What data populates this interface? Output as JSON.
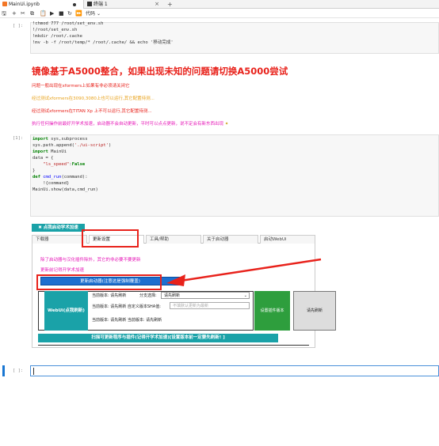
{
  "tabs": [
    {
      "label": "MainUi.ipynb",
      "icon": "notebook-icon"
    },
    {
      "label": "终端 1",
      "icon": "terminal-icon"
    }
  ],
  "toolbar": {
    "cell_type": "代码",
    "icons": [
      "save-icon",
      "add-icon",
      "cut-icon",
      "copy-icon",
      "paste-icon",
      "run-icon",
      "stop-icon",
      "restart-icon",
      "fast-forward-icon"
    ]
  },
  "cell1": {
    "prompt": "[ ]:",
    "lines": [
      "!chmod 777 /root/set_env.sh",
      "!/root/set_env.sh",
      "!mkdir /root/.cache",
      "!mv -b -f /root/temp/* /root/.cache/ && echo '移动完成'"
    ]
  },
  "markdown": {
    "title": "镜像基于A5000整合，如果出现未知的问题请切换A5000尝试",
    "line1": "问题一般出现在xformers上如果有非必须请关闭它",
    "line2": "经过测试xformers在3090,3080上也可以运行,其它配置待测...",
    "line3": "经过测试xformers在TITAN Xp 上不可以运行,其它配置待测...",
    "line4": "执行任何操作前最好开学术加速，启动器不会自动更新，平时可以点点更新，说不定会有新东西出现"
  },
  "cell2": {
    "prompt": "[1]:",
    "lines": [
      "import sys,subprocess",
      "sys.path.append('./ui-script')",
      "import MainUi",
      "",
      "data = {",
      "    \"ls_speed\":False",
      "}",
      "",
      "def cmd_run(command):",
      "    !{command}",
      "",
      "MainUi.show(data,cmd_run)"
    ]
  },
  "widget": {
    "open_btn": "✖ 点我启动学术加速",
    "tabs": [
      "下载器",
      "更新设置",
      "工具/帮助",
      "关于启动器",
      "启动WebUi"
    ],
    "note1": "除了启动器与汉化插件除外，其它的非必要不要更新",
    "note2": "更新前记得开学术加速",
    "update_btn": "更新启动器(注意这是强制覆盖)",
    "webui_btn": "WebUi(点我刷新)",
    "info1": "当前版本: 请先刷新",
    "branch_label": "分支选择:",
    "branch_value": "请先刷新",
    "info2": "当前版本: 请先刷新 自定义版本SHA值:",
    "sha_placeholder": "不填默认更新为最新",
    "info3": "当前版本: 请先刷新 当前版本: 请先刷新",
    "set_btn": "设置插件版本",
    "refresh_btn": "请先刷新",
    "scan_btn": "扫描可更新程序与插件(记得开学术加速)[设置版本前一定要先刷新! ]"
  },
  "cell3": {
    "prompt": "[ ]:"
  }
}
